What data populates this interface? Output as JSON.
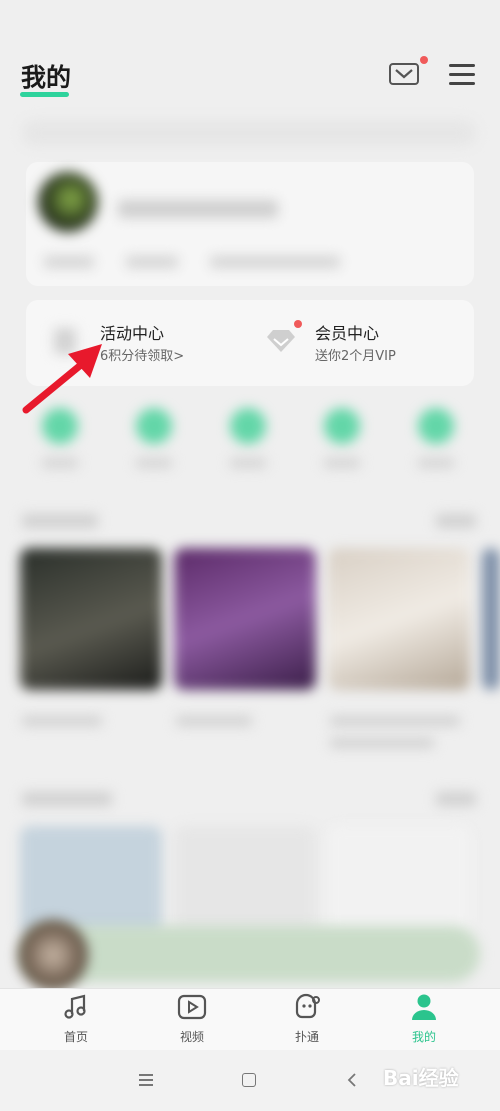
{
  "header": {
    "title": "我的"
  },
  "activity": {
    "title": "活动中心",
    "subtitle": "6积分待领取>"
  },
  "vip": {
    "title": "会员中心",
    "subtitle": "送你2个月VIP"
  },
  "tabs": [
    {
      "label": "首页",
      "icon": "music-note-icon"
    },
    {
      "label": "视频",
      "icon": "video-play-icon"
    },
    {
      "label": "扑通",
      "icon": "face-bubble-icon"
    },
    {
      "label": "我的",
      "icon": "user-icon",
      "active": true
    }
  ],
  "watermark": "Bai经验",
  "colors": {
    "accent": "#2bc48d",
    "badge": "#f05a5a",
    "arrow": "#e8192c"
  }
}
